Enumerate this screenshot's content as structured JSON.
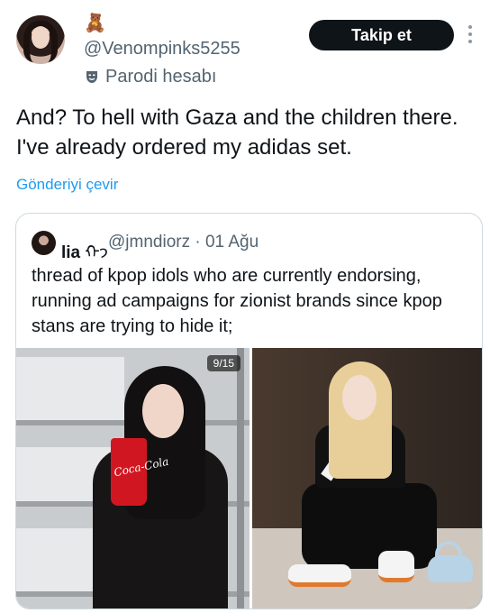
{
  "author": {
    "emoji": "🧸",
    "username": "@Venompinks5255",
    "parody_label": "Parodi hesabı"
  },
  "follow_button_label": "Takip et",
  "tweet": {
    "text": "And? To hell with Gaza and the children there. I've already ordered my adidas set.",
    "translate_label": "Gönderiyi çevir"
  },
  "quote": {
    "name": "lia",
    "name_glyph": "ᡣ𐭩",
    "handle_line": "@jmndiorz · 01 Ağu",
    "text": "thread of kpop idols who are currently endorsing, running ad campaigns for zionist brands since kpop stans are trying to hide it;",
    "media_counter": "9/15",
    "cup_brand": "Coca-Cola"
  },
  "colors": {
    "link": "#1d9bf0",
    "secondary_text": "#536471",
    "button_bg": "#0f1419"
  }
}
